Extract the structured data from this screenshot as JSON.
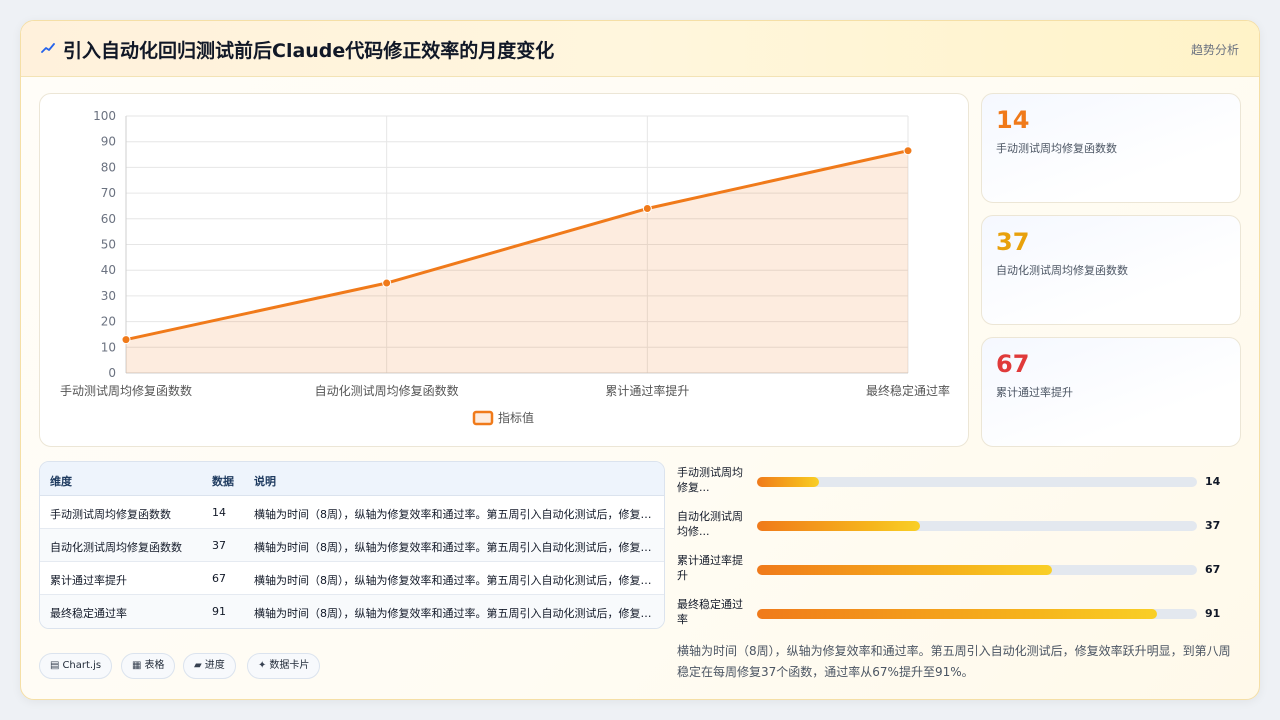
{
  "header": {
    "title": "引入自动化回归测试前后Claude代码修正效率的月度变化",
    "tag": "趋势分析"
  },
  "colors": {
    "accent": "#f07a1a",
    "stat1": "#f07a1a",
    "stat2": "#e8a10c",
    "stat3": "#e03a3a"
  },
  "stats": [
    {
      "value": "14",
      "label": "手动测试周均修复函数数"
    },
    {
      "value": "37",
      "label": "自动化测试周均修复函数数"
    },
    {
      "value": "67",
      "label": "累计通过率提升"
    }
  ],
  "table": {
    "headers": [
      "维度",
      "数据",
      "说明"
    ],
    "rows": [
      {
        "dim": "手动测试周均修复函数数",
        "val": "14",
        "desc": "横轴为时间（8周），纵轴为修复效率和通过率。第五周引入自动化测试后，修复效率跃升明显"
      },
      {
        "dim": "自动化测试周均修复函数数",
        "val": "37",
        "desc": "横轴为时间（8周），纵轴为修复效率和通过率。第五周引入自动化测试后，修复效率跃升明显"
      },
      {
        "dim": "累计通过率提升",
        "val": "67",
        "desc": "横轴为时间（8周），纵轴为修复效率和通过率。第五周引入自动化测试后，修复效率跃升明显"
      },
      {
        "dim": "最终稳定通过率",
        "val": "91",
        "desc": "横轴为时间（8周），纵轴为修复效率和通过率。第五周引入自动化测试后，修复效率跃升明显"
      }
    ]
  },
  "progress": [
    {
      "label": "手动测试周均修复...",
      "value": 14
    },
    {
      "label": "自动化测试周均修...",
      "value": 37
    },
    {
      "label": "累计通过率提升",
      "value": 67
    },
    {
      "label": "最终稳定通过率",
      "value": 91
    }
  ],
  "chips": [
    {
      "icon": "▤",
      "label": "Chart.js"
    },
    {
      "icon": "▦",
      "label": "表格"
    },
    {
      "icon": "▰",
      "label": "进度"
    },
    {
      "icon": "✦",
      "label": "数据卡片"
    }
  ],
  "note": "横轴为时间（8周），纵轴为修复效率和通过率。第五周引入自动化测试后，修复效率跃升明显，到第八周稳定在每周修复37个函数，通过率从67%提升至91%。",
  "chart_data": {
    "type": "line",
    "categories": [
      "手动测试周均修复函数数",
      "自动化测试周均修复函数数",
      "累计通过率提升",
      "最终稳定通过率"
    ],
    "series": [
      {
        "name": "指标值",
        "values": [
          13,
          35,
          64,
          86.5
        ]
      }
    ],
    "ylim": [
      0,
      100
    ],
    "yticks": [
      0,
      10,
      20,
      30,
      40,
      50,
      60,
      70,
      80,
      90,
      100
    ],
    "grid": true,
    "fill": true,
    "legend": "bottom"
  }
}
